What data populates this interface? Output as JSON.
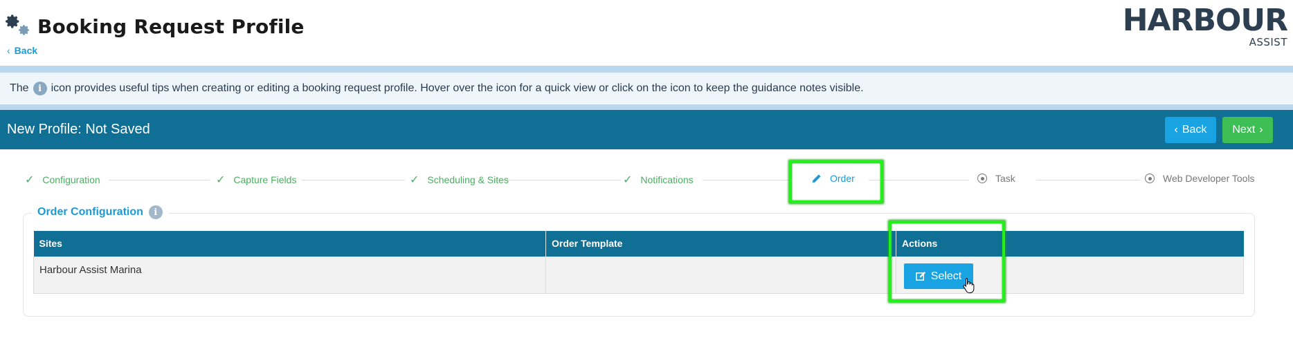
{
  "header": {
    "title": "Booking Request Profile",
    "back_label": "Back",
    "logo_main": "HARBOUR",
    "logo_sub": "ASSIST"
  },
  "info": {
    "text_before": "The",
    "icon_glyph": "i",
    "text_after": "icon provides useful tips when creating or editing a booking request profile. Hover over the icon for a quick view or click on the icon to keep the guidance notes visible."
  },
  "profile_bar": {
    "title": "New Profile: Not Saved",
    "back_label": "Back",
    "next_label": "Next"
  },
  "steps": [
    {
      "label": "Configuration",
      "state": "done"
    },
    {
      "label": "Capture Fields",
      "state": "done"
    },
    {
      "label": "Scheduling & Sites",
      "state": "done"
    },
    {
      "label": "Notifications",
      "state": "done"
    },
    {
      "label": "Order",
      "state": "active"
    },
    {
      "label": "Task",
      "state": "todo"
    },
    {
      "label": "Web Developer Tools",
      "state": "todo"
    }
  ],
  "order_config": {
    "legend": "Order Configuration",
    "columns": {
      "sites": "Sites",
      "template": "Order Template",
      "actions": "Actions"
    },
    "rows": [
      {
        "site": "Harbour Assist Marina",
        "template": "",
        "action_label": "Select"
      }
    ]
  },
  "colors": {
    "primary_bar": "#106f95",
    "accent_blue": "#1aa3e3",
    "success_green": "#3dbf55",
    "highlight_green": "#22f01a"
  }
}
